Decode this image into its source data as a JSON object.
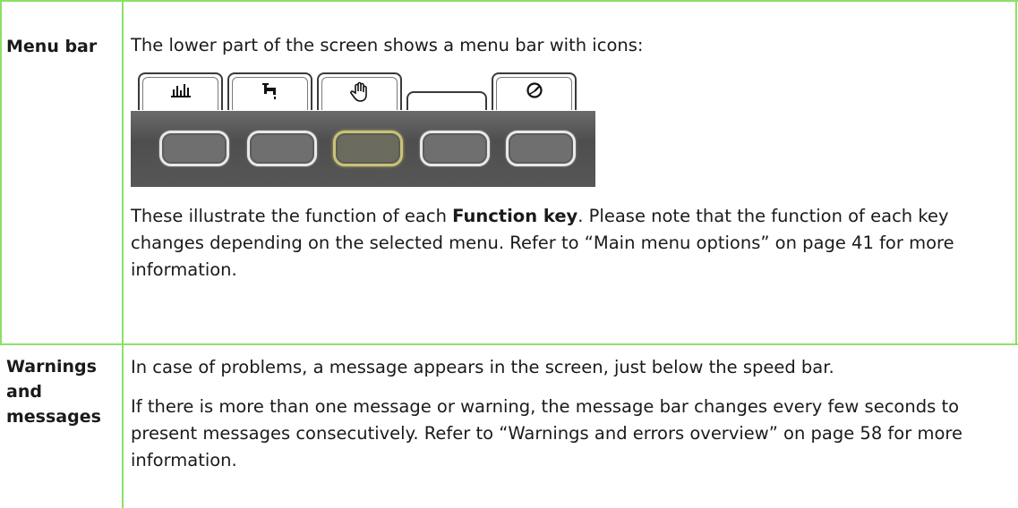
{
  "rows": [
    {
      "label": "Menu bar",
      "intro": "The lower part of the screen shows a menu bar with icons:",
      "function_key_text": {
        "before": "These illustrate the function of each ",
        "bold": "Function key",
        "after": ". Please note that the function of each key changes depending on the selected menu. Refer to “Main menu options” on page 41 for more information."
      }
    },
    {
      "label": "Warnings\nand\nmessages",
      "para1": "In case of problems, a message appears in the screen, just below the speed bar.",
      "para2": "If there is more than one message or warning, the message bar changes every few seconds to present messages consecutively. Refer to “Warnings and errors overview” on page 58 for more information."
    }
  ],
  "menu_illustration": {
    "tabs": [
      {
        "icon": "bar-chart-icon"
      },
      {
        "icon": "tap-icon"
      },
      {
        "icon": "hand-icon"
      },
      {
        "icon": "empty-tab"
      },
      {
        "icon": "gauge-icon"
      }
    ],
    "keys": [
      {
        "selected": false
      },
      {
        "selected": false
      },
      {
        "selected": true
      },
      {
        "selected": false
      },
      {
        "selected": false
      }
    ]
  },
  "colors": {
    "rule": "#8be06a",
    "key_border": "#e8e8e8",
    "key_selected_border": "#c9c27a",
    "key_strip": "#555555"
  }
}
